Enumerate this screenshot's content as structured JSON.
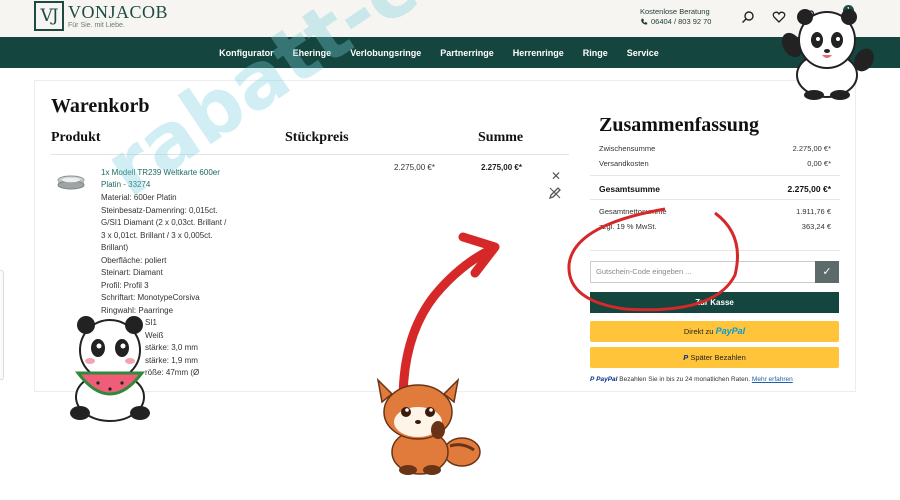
{
  "header": {
    "logo_mark": "VJ",
    "brand": "VONJACOB",
    "tagline": "Für Sie. mit Liebe.",
    "contact_label": "Kostenlose Beratung",
    "phone": "06404 / 803 92 70",
    "cart_count": "1",
    "icons": [
      "search-icon",
      "heart-icon",
      "bag-icon"
    ]
  },
  "nav": {
    "items": [
      "Konfigurator",
      "Eheringe",
      "Verlobungsringe",
      "Partnerringe",
      "Herrenringe",
      "Ringe",
      "Service"
    ]
  },
  "cart": {
    "title": "Warenkorb",
    "col_product": "Produkt",
    "col_unit": "Stückpreis",
    "col_sum": "Summe",
    "item": {
      "title": "1x Modell TR239 Weltkarte 600er Platin - 33274",
      "specs": [
        "Material: 600er Platin",
        "Steinbesatz-Damenring: 0,015ct.",
        "G/SI1 Diamant (2 x 0,03ct. Brillant /",
        "3 x 0,01ct. Brillant / 3 x 0,005ct.",
        "Brillant)",
        "Oberfläche: poliert",
        "Steinart: Diamant",
        "Profil: Profil 3",
        "Schriftart: MonotypeCorsiva",
        "Ringwahl: Paarringe",
        "SI1",
        "Weiß",
        "stärke: 3,0 mm",
        "stärke: 1,9 mm",
        "röße: 47mm (Ø"
      ],
      "unit_price": "2.275,00 €*",
      "line_total": "2.275,00 €*"
    }
  },
  "summary": {
    "title": "Zusammenfassung",
    "subtotal_label": "Zwischensumme",
    "subtotal": "2.275,00 €*",
    "shipping_label": "Versandkosten",
    "shipping": "0,00 €*",
    "total_label": "Gesamtsumme",
    "total": "2.275,00 €*",
    "net_label": "Gesamtnettosumme",
    "net": "1.911,76 €",
    "vat_label": "zzgl. 19 % MwSt.",
    "vat": "363,24 €",
    "coupon_placeholder": "Gutschein-Code eingeben ...",
    "checkout_label": "Zur Kasse",
    "paypal_prefix": "Direkt zu",
    "paypal_pay": "Pay",
    "paypal_pal": "Pal",
    "later_label": "Später Bezahlen",
    "note_brand": "PayPal",
    "note_text": "Bezahlen Sie in bis zu 24 monatlichen Raten.",
    "note_link": "Mehr erfahren"
  },
  "overlay": {
    "watermark": "rabatt-coupon.com"
  },
  "colors": {
    "brand_green": "#14453e",
    "paypal_yellow": "#ffc439",
    "watermark": "#78cddc"
  }
}
